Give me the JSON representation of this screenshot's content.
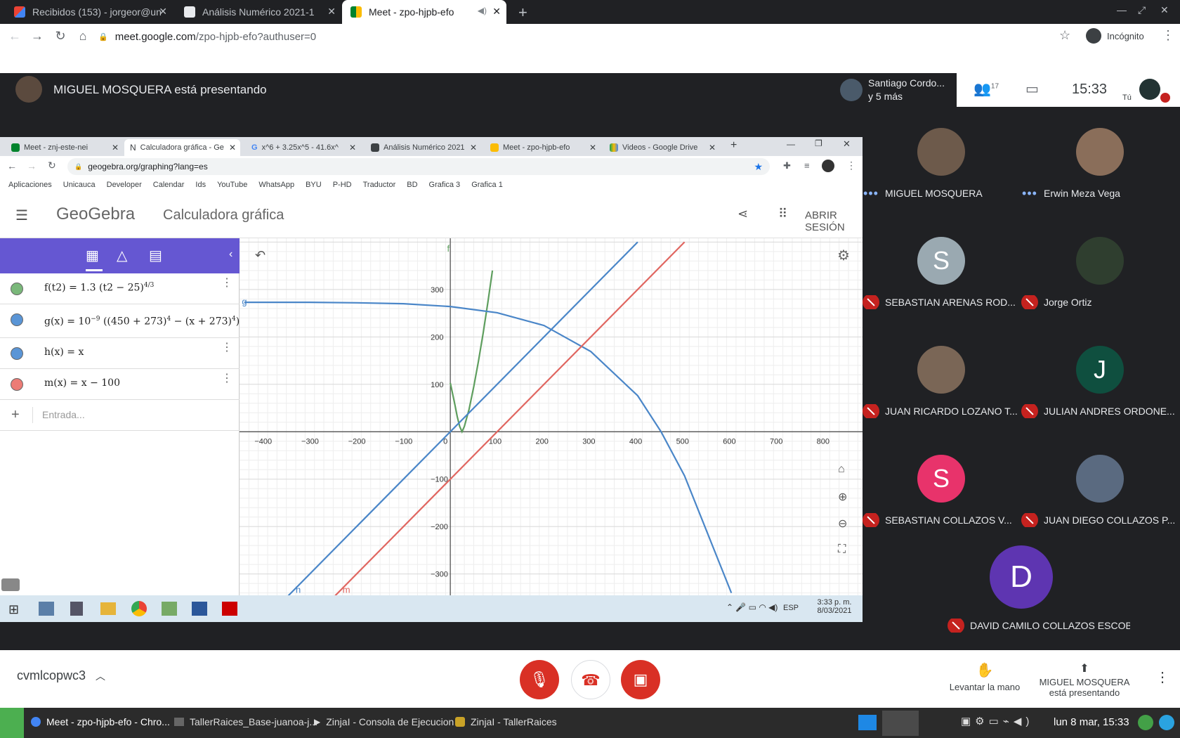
{
  "browser": {
    "tabs": [
      {
        "title": "Recibidos (153) - jorgeor@un",
        "close": "✕"
      },
      {
        "title": "Análisis Numérico 2021-1",
        "close": "✕"
      },
      {
        "title": "Meet - zpo-hjpb-efo",
        "close": "✕",
        "active": true
      }
    ],
    "new_tab": "+",
    "url_domain": "meet.google.com",
    "url_path": "/zpo-hjpb-efo?authuser=0",
    "incognito_label": "Incógnito"
  },
  "meet": {
    "presenter_banner": "MIGUEL MOSQUERA está presentando",
    "top_participant_line1": "Santiago Cordo...",
    "top_participant_line2": "y 5 más",
    "people_count": "17",
    "clock": "15:33",
    "you_label": "Tú",
    "meeting_code": "cvmlcopwc3",
    "raise_hand_label": "Levantar la mano",
    "presenting_line1": "MIGUEL MOSQUERA",
    "presenting_line2": "está presentando",
    "participants": [
      {
        "name": "MIGUEL MOSQUERA",
        "status": "speaking",
        "initial": ""
      },
      {
        "name": "Erwin Meza Vega",
        "status": "speaking",
        "initial": ""
      },
      {
        "name": "SEBASTIAN ARENAS ROD...",
        "status": "muted",
        "initial": "S",
        "color": "#9aa9b1"
      },
      {
        "name": "Jorge Ortiz",
        "status": "muted",
        "initial": ""
      },
      {
        "name": "JUAN RICARDO LOZANO T...",
        "status": "muted",
        "initial": ""
      },
      {
        "name": "JULIAN ANDRES ORDONE...",
        "status": "muted",
        "initial": "J",
        "color": "#0f4f3f"
      },
      {
        "name": "SEBASTIAN COLLAZOS V...",
        "status": "muted",
        "initial": "S",
        "color": "#e8336b"
      },
      {
        "name": "JUAN DIEGO COLLAZOS P...",
        "status": "muted",
        "initial": ""
      },
      {
        "name": "DAVID CAMILO COLLAZOS ESCOBAR",
        "status": "muted",
        "initial": "D",
        "color": "#5e35b1"
      }
    ]
  },
  "shared": {
    "tabs": [
      {
        "title": "Meet - znj-este-nei",
        "active": false
      },
      {
        "title": "Calculadora gráfica - Ge",
        "active": true
      },
      {
        "title": "x^6 + 3.25x^5 - 41.6x^",
        "active": false
      },
      {
        "title": "Análisis Numérico 2021",
        "active": false
      },
      {
        "title": "Meet - zpo-hjpb-efo",
        "active": false
      },
      {
        "title": "Videos - Google Drive",
        "active": false
      }
    ],
    "url": "geogebra.org/graphing?lang=es",
    "bookmarks": [
      "Aplicaciones",
      "Unicauca",
      "Developer",
      "Calendar",
      "Ids",
      "YouTube",
      "WhatsApp",
      "BYU",
      "P-HD",
      "Traductor",
      "BD",
      "Grafica 3",
      "Grafica 1"
    ],
    "app_logo": "GeoGebra",
    "app_title": "Calculadora gráfica",
    "signin": "ABRIR SESIÓN",
    "input_placeholder": "Entrada...",
    "functions": [
      {
        "label": "f(t2)",
        "expr": "f(t2) = 1.3 (t2 − 25)^(4/3)",
        "color": "#5e9e5e"
      },
      {
        "label": "g(x)",
        "expr": "g(x) = 10^(−9) ((450 + 273)^4 − (x + 273)^4)",
        "color": "#4a86c8"
      },
      {
        "label": "h(x)",
        "expr": "h(x) = x",
        "color": "#4a86c8"
      },
      {
        "label": "m(x)",
        "expr": "m(x) = x − 100",
        "color": "#e06660"
      }
    ],
    "curve_labels": [
      "f",
      "g",
      "h",
      "m"
    ],
    "x_ticks": [
      "−400",
      "−300",
      "−200",
      "−100",
      "0",
      "100",
      "200",
      "300",
      "400",
      "500",
      "600",
      "700",
      "800"
    ],
    "y_ticks": [
      "300",
      "200",
      "100",
      "−100",
      "−200",
      "−300"
    ],
    "taskbar_lang": "ESP",
    "taskbar_time": "3:33 p. m.",
    "taskbar_date": "8/03/2021"
  },
  "chart_data": {
    "type": "line",
    "xlim": [
      -450,
      880
    ],
    "ylim": [
      -345,
      408
    ],
    "grid": true,
    "series": [
      {
        "name": "f",
        "color": "#5e9e5e",
        "x": [
          0,
          5,
          10,
          15,
          20,
          25,
          30,
          40,
          50,
          60,
          70,
          80,
          90
        ],
        "y": [
          103,
          80,
          56,
          31,
          11,
          0,
          11,
          47,
          95,
          148,
          207,
          272,
          340
        ]
      },
      {
        "name": "g",
        "color": "#4a86c8",
        "x": [
          -440,
          -300,
          -200,
          -100,
          0,
          100,
          200,
          300,
          400,
          450,
          500,
          600
        ],
        "y": [
          273,
          273,
          272,
          270,
          264,
          251,
          224,
          169,
          76,
          0,
          -93,
          -340
        ]
      },
      {
        "name": "h",
        "color": "#4a86c8",
        "x": [
          -360,
          400
        ],
        "y": [
          -360,
          400
        ]
      },
      {
        "name": "m",
        "color": "#e06660",
        "x": [
          -260,
          500
        ],
        "y": [
          -360,
          400
        ]
      }
    ]
  },
  "os_bar": {
    "tasks": [
      "Meet - zpo-hjpb-efo - Chro...",
      "TallerRaices_Base-juanoa-j...",
      "ZinjaI - Consola de Ejecucion",
      "ZinjaI - TallerRaices"
    ],
    "clock": "lun 8 mar, 15:33"
  }
}
